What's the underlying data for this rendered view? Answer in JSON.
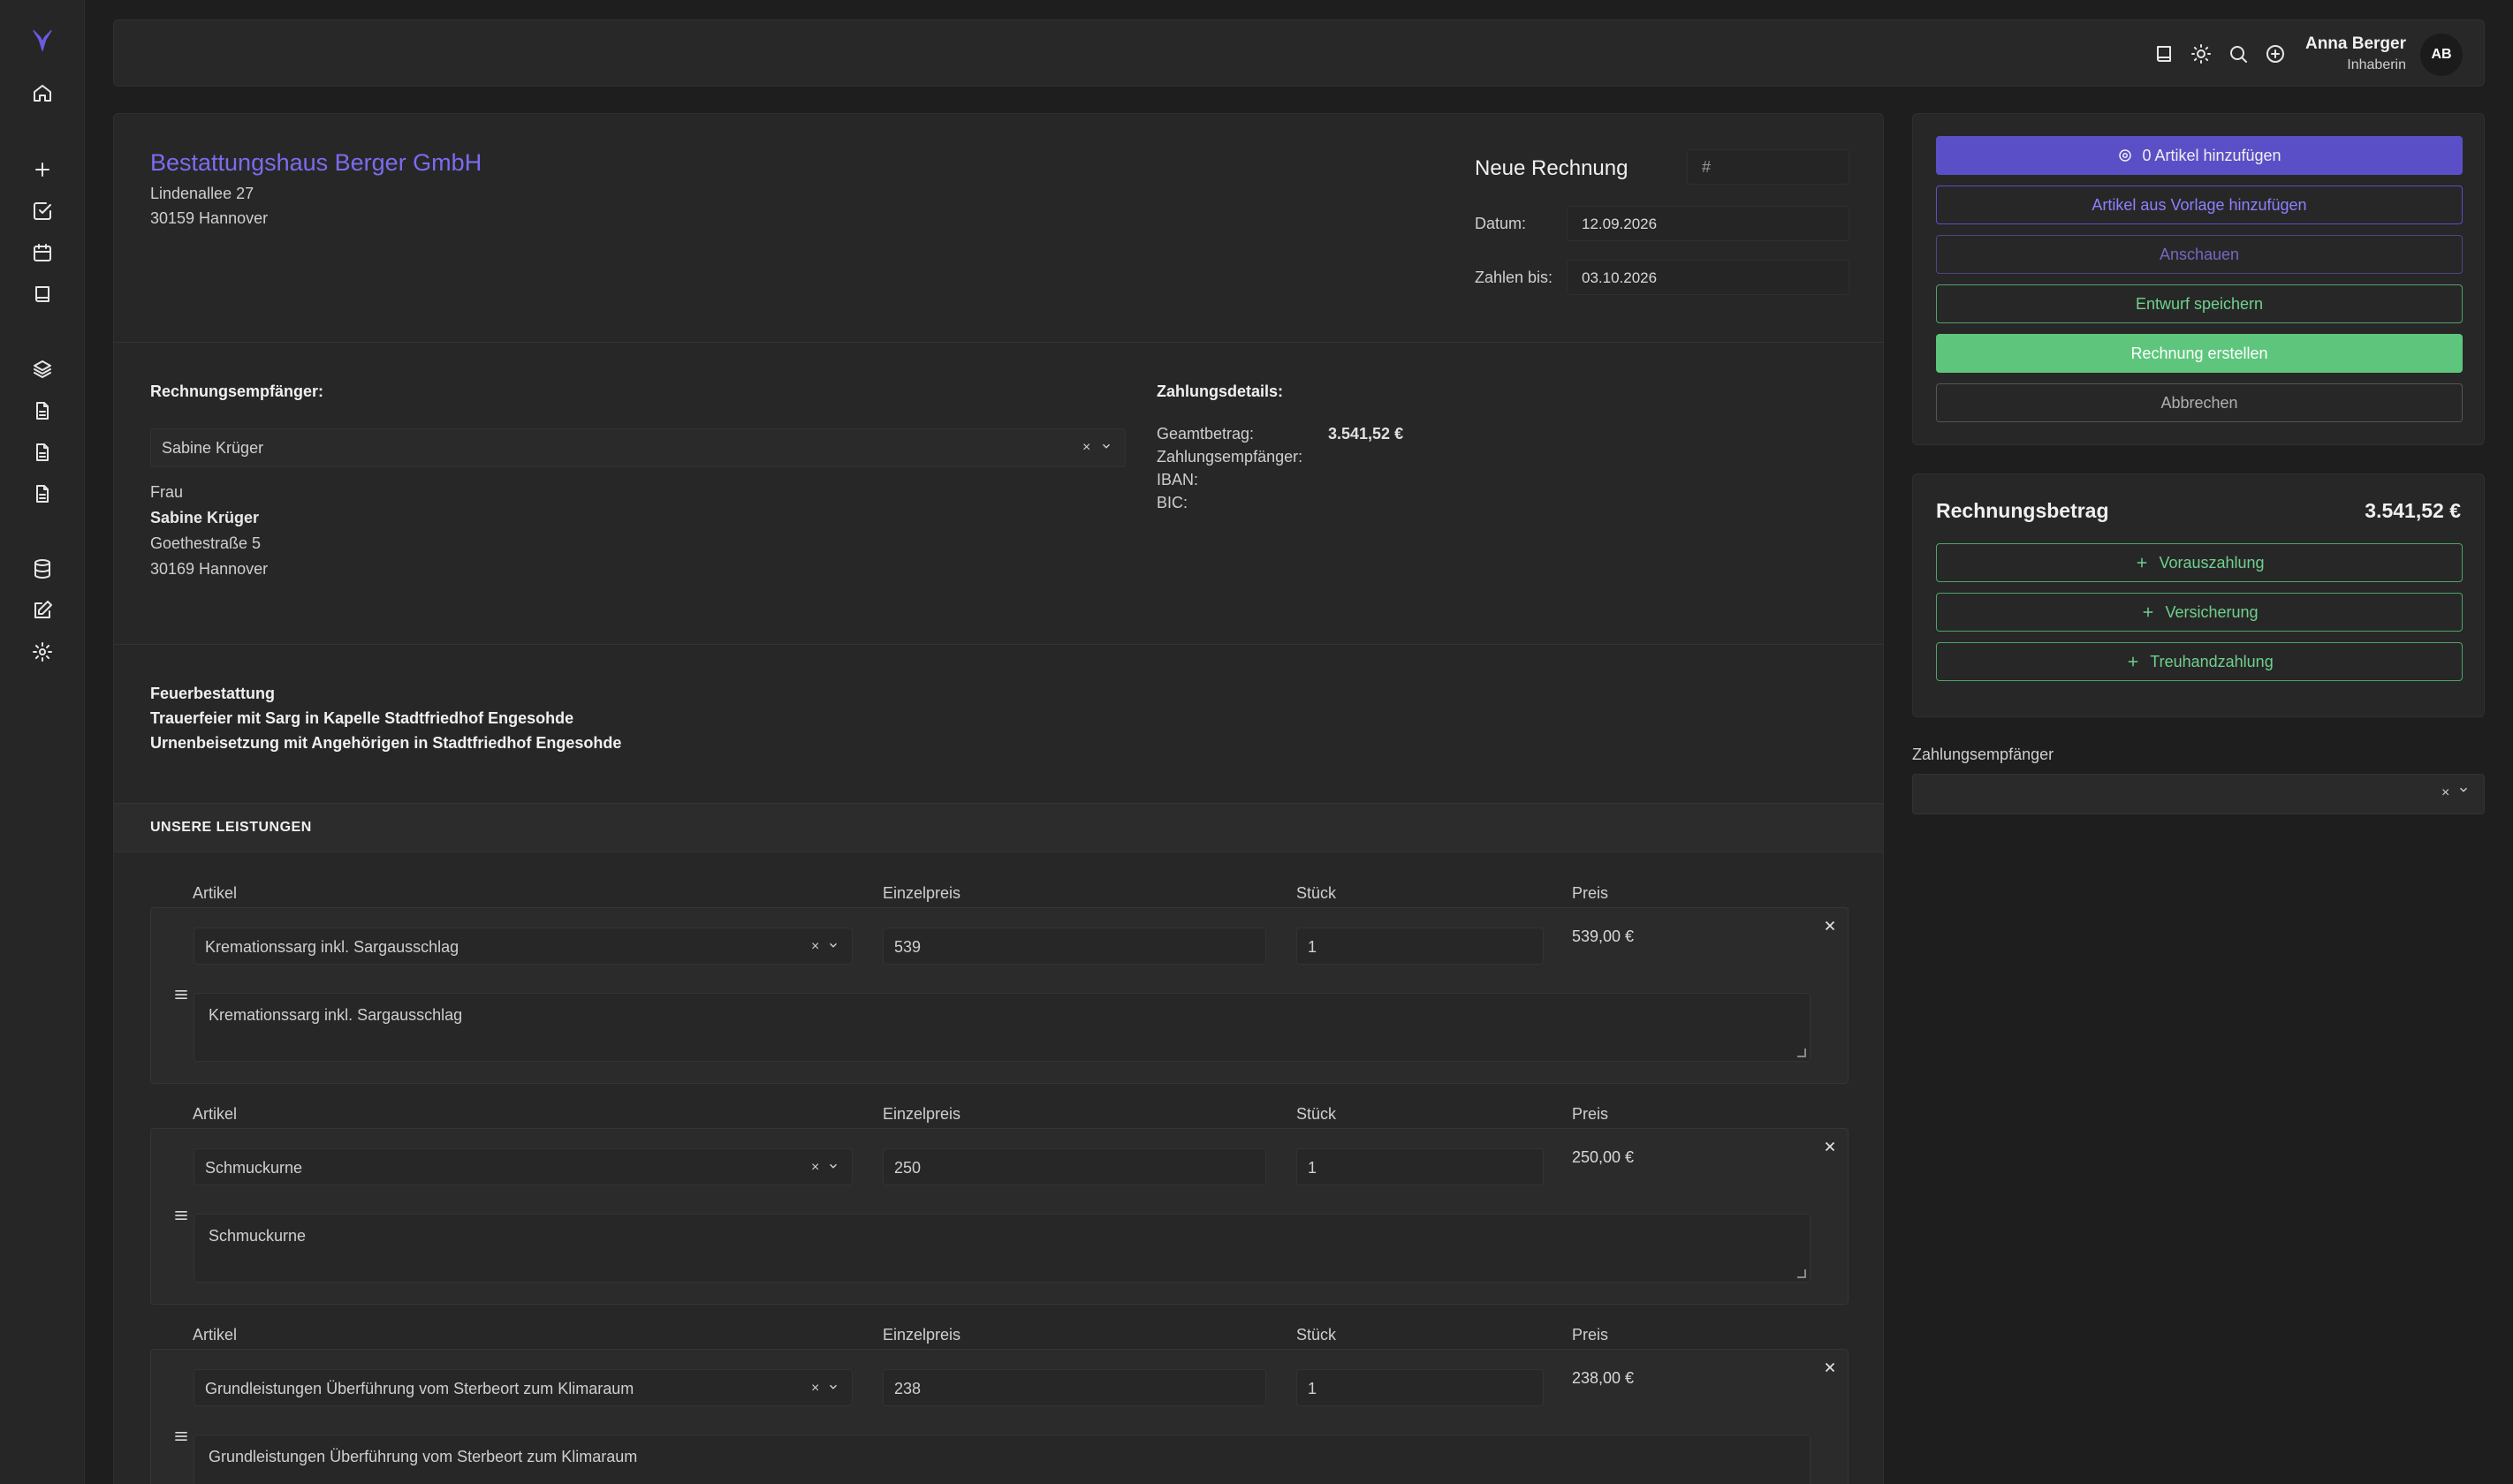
{
  "colors": {
    "accent": "#5b4fc7",
    "accent_text": "#7b6cf0",
    "success": "#5dc67c",
    "success_text": "#6fd18e",
    "background": "#1e1e1e",
    "panel": "#272727"
  },
  "sidebar": {
    "logo_icon": "fox-logo-icon",
    "items": [
      {
        "icon": "home-icon"
      },
      {
        "icon": "plus-icon"
      },
      {
        "icon": "check-square-icon"
      },
      {
        "icon": "calendar-icon"
      },
      {
        "icon": "book-icon"
      },
      {
        "icon": "layers-icon"
      },
      {
        "icon": "document-icon"
      },
      {
        "icon": "document-icon"
      },
      {
        "icon": "document-icon"
      },
      {
        "icon": "database-icon"
      },
      {
        "icon": "edit-icon"
      },
      {
        "icon": "gear-icon"
      }
    ]
  },
  "topbar": {
    "icons": [
      "book-icon",
      "sun-icon",
      "search-icon",
      "plus-circle-icon"
    ],
    "user_name": "Anna Berger",
    "user_role": "Inhaberin",
    "avatar_initials": "AB"
  },
  "invoice": {
    "company_name": "Bestattungshaus Berger GmbH",
    "company_street": "Lindenallee 27",
    "company_city": "30159 Hannover",
    "title": "Neue Rechnung",
    "number_placeholder": "#",
    "date_label": "Datum:",
    "date_value": "12.09.2026",
    "due_label": "Zahlen bis:",
    "due_value": "03.10.2026"
  },
  "recipient": {
    "heading": "Rechnungsempfänger:",
    "selected": "Sabine Krüger",
    "salutation": "Frau",
    "name": "Sabine Krüger",
    "street": "Goethestraße 5",
    "city": "30169 Hannover"
  },
  "payment": {
    "heading": "Zahlungsdetails:",
    "total_label": "Geamtbetrag:",
    "total_value": "3.541,52 €",
    "payee_label": "Zahlungsempfänger:",
    "iban_label": "IBAN:",
    "bic_label": "BIC:"
  },
  "services": {
    "lines": [
      "Feuerbestattung",
      "Trauerfeier mit Sarg in Kapelle Stadtfriedhof Engesohde",
      "Urnenbeisetzung mit Angehörigen in Stadtfriedhof Engesohde"
    ],
    "section_title": "UNSERE LEISTUNGEN"
  },
  "items_header": {
    "article": "Artikel",
    "unit_price": "Einzelpreis",
    "quantity": "Stück",
    "price": "Preis"
  },
  "items": [
    {
      "article": "Kremationssarg inkl. Sargausschlag",
      "unit_price": "539",
      "quantity": "1",
      "price": "539,00 €",
      "description": "Kremationssarg inkl. Sargausschlag"
    },
    {
      "article": "Schmuckurne",
      "unit_price": "250",
      "quantity": "1",
      "price": "250,00 €",
      "description": "Schmuckurne"
    },
    {
      "article": "Grundleistungen Überführung vom Sterbeort zum Klimaraum",
      "unit_price": "238",
      "quantity": "1",
      "price": "238,00 €",
      "description": "Grundleistungen Überführung vom Sterbeort zum Klimaraum"
    }
  ],
  "actions": {
    "add_items": "0 Artikel hinzufügen",
    "add_from_template": "Artikel aus Vorlage hinzufügen",
    "preview": "Anschauen",
    "save_draft": "Entwurf speichern",
    "create_invoice": "Rechnung erstellen",
    "cancel": "Abbrechen"
  },
  "amount": {
    "title": "Rechnungsbetrag",
    "value": "3.541,52 €",
    "prepayment": "Vorauszahlung",
    "insurance": "Versicherung",
    "trust_payment": "Treuhandzahlung"
  },
  "payee_select": {
    "label": "Zahlungsempfänger"
  }
}
